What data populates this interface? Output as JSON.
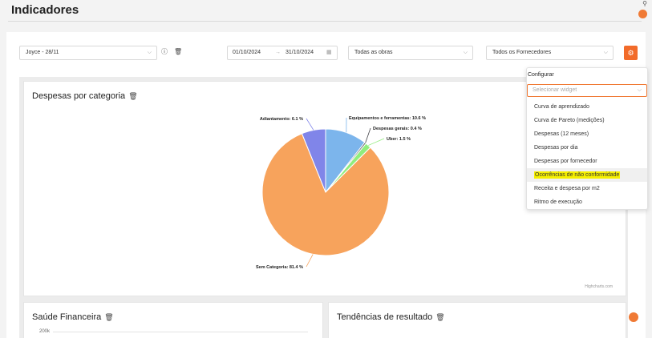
{
  "page_title": "Indicadores",
  "filters": {
    "user_select": "Joyce - 28/11",
    "date_start": "01/10/2024",
    "date_sep": "→",
    "date_end": "31/10/2024",
    "works_select": "Todas as obras",
    "suppliers_select": "Todos os Fornecedores"
  },
  "cards": {
    "despesas": {
      "title": "Despesas por categoria"
    },
    "saude": {
      "title": "Saúde Financeira",
      "axis_label": "200k"
    },
    "tendencias": {
      "title": "Tendências de resultado"
    }
  },
  "chart_data": {
    "type": "pie",
    "title": "Despesas por categoria",
    "series": [
      {
        "name": "Equipamentos e ferramentas",
        "value": 10.6,
        "label": "Equipamentos e ferramentas: 10.6 %",
        "color": "#7cb5ec"
      },
      {
        "name": "Despesas gerais",
        "value": 0.4,
        "label": "Despesas gerais: 0.4 %",
        "color": "#434348"
      },
      {
        "name": "Uber",
        "value": 1.5,
        "label": "Uber: 1.5 %",
        "color": "#90ed7d"
      },
      {
        "name": "Sem Categoria",
        "value": 81.4,
        "label": "Sem Categoria: 81.4 %",
        "color": "#f7a35c"
      },
      {
        "name": "Adiantamento",
        "value": 6.1,
        "label": "Adiantamento: 6.1 %",
        "color": "#8085e9"
      }
    ],
    "credits": "Highcharts.com"
  },
  "dropdown": {
    "label": "Configurar",
    "placeholder": "Selecionar widget",
    "items": [
      "Curva de aprendizado",
      "Curva de Pareto (medições)",
      "Despesas (12 meses)",
      "Despesas por dia",
      "Despesas por fornecedor",
      "Ocorrências de não conformidade",
      "Receita e despesa por m2",
      "Ritmo de execução"
    ],
    "highlighted_index": 5
  },
  "colors": {
    "accent": "#f26b2a"
  }
}
